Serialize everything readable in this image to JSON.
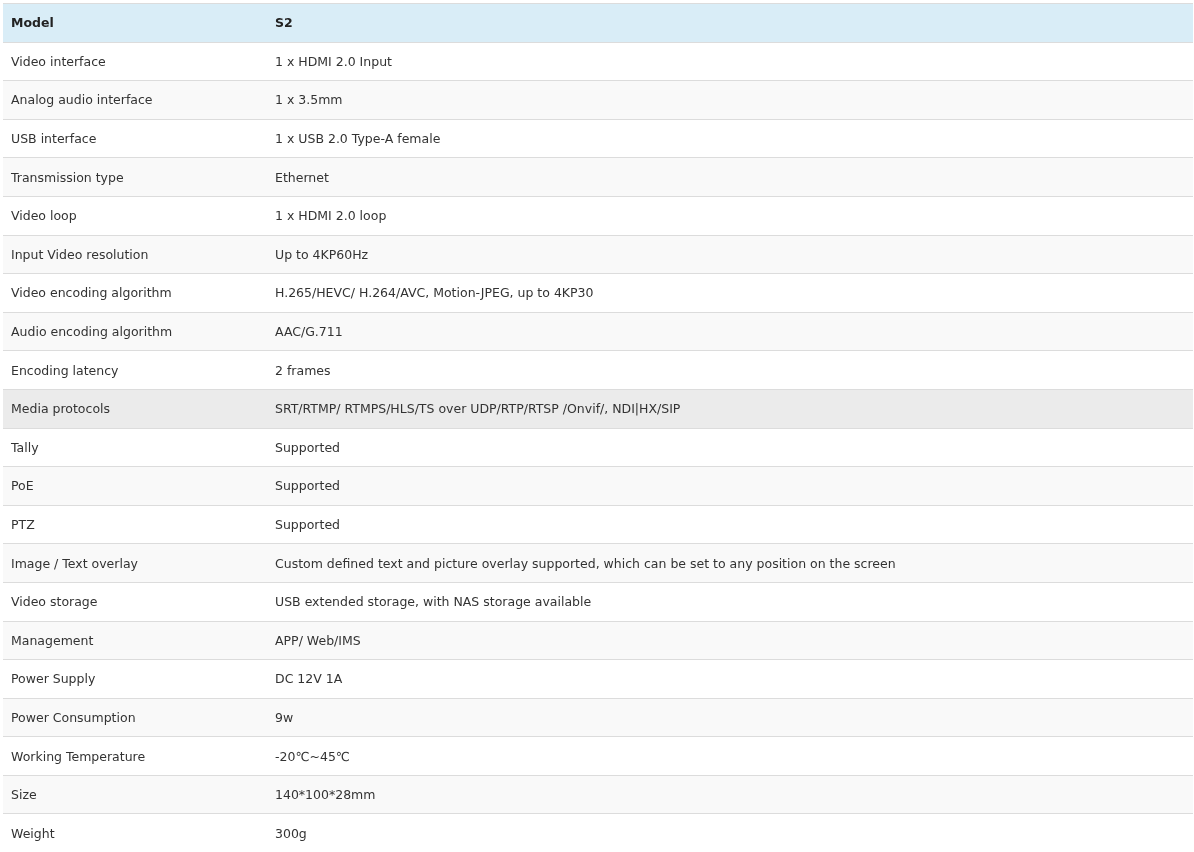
{
  "table": {
    "columns": [
      "Model",
      "S2"
    ],
    "rows": [
      {
        "cells": [
          "Video interface",
          "1 x HDMI 2.0 Input"
        ],
        "highlighted": false
      },
      {
        "cells": [
          "Analog audio interface",
          "1 x 3.5mm"
        ],
        "highlighted": false
      },
      {
        "cells": [
          "USB interface",
          "1 x USB 2.0 Type-A female"
        ],
        "highlighted": false
      },
      {
        "cells": [
          "Transmission type",
          "Ethernet"
        ],
        "highlighted": false
      },
      {
        "cells": [
          "Video loop",
          "1 x HDMI 2.0 loop"
        ],
        "highlighted": false
      },
      {
        "cells": [
          "Input Video resolution",
          "Up to 4KP60Hz"
        ],
        "highlighted": false
      },
      {
        "cells": [
          "Video encoding algorithm",
          "H.265/HEVC/ H.264/AVC, Motion-JPEG, up to 4KP30"
        ],
        "highlighted": false
      },
      {
        "cells": [
          "Audio encoding algorithm",
          "AAC/G.711"
        ],
        "highlighted": false
      },
      {
        "cells": [
          "Encoding latency",
          "2 frames"
        ],
        "highlighted": false
      },
      {
        "cells": [
          "Media protocols",
          "SRT/RTMP/ RTMPS/HLS/TS over UDP/RTP/RTSP /Onvif/, NDI|HX/SIP"
        ],
        "highlighted": true
      },
      {
        "cells": [
          "Tally",
          "Supported"
        ],
        "highlighted": false
      },
      {
        "cells": [
          "PoE",
          "Supported"
        ],
        "highlighted": false
      },
      {
        "cells": [
          "PTZ",
          "Supported"
        ],
        "highlighted": false
      },
      {
        "cells": [
          "Image / Text overlay",
          "Custom defined text and picture overlay supported, which can be set to any position on the screen"
        ],
        "highlighted": false
      },
      {
        "cells": [
          "Video storage",
          "USB extended storage, with NAS storage available"
        ],
        "highlighted": false
      },
      {
        "cells": [
          "Management",
          "APP/ Web/IMS"
        ],
        "highlighted": false
      },
      {
        "cells": [
          "Power Supply",
          "DC 12V 1A"
        ],
        "highlighted": false
      },
      {
        "cells": [
          "Power Consumption",
          "9w"
        ],
        "highlighted": false
      },
      {
        "cells": [
          "Working Temperature",
          "-20℃~45℃"
        ],
        "highlighted": false
      },
      {
        "cells": [
          "Size",
          "140*100*28mm"
        ],
        "highlighted": false
      },
      {
        "cells": [
          "Weight",
          "300g"
        ],
        "highlighted": false
      }
    ]
  }
}
